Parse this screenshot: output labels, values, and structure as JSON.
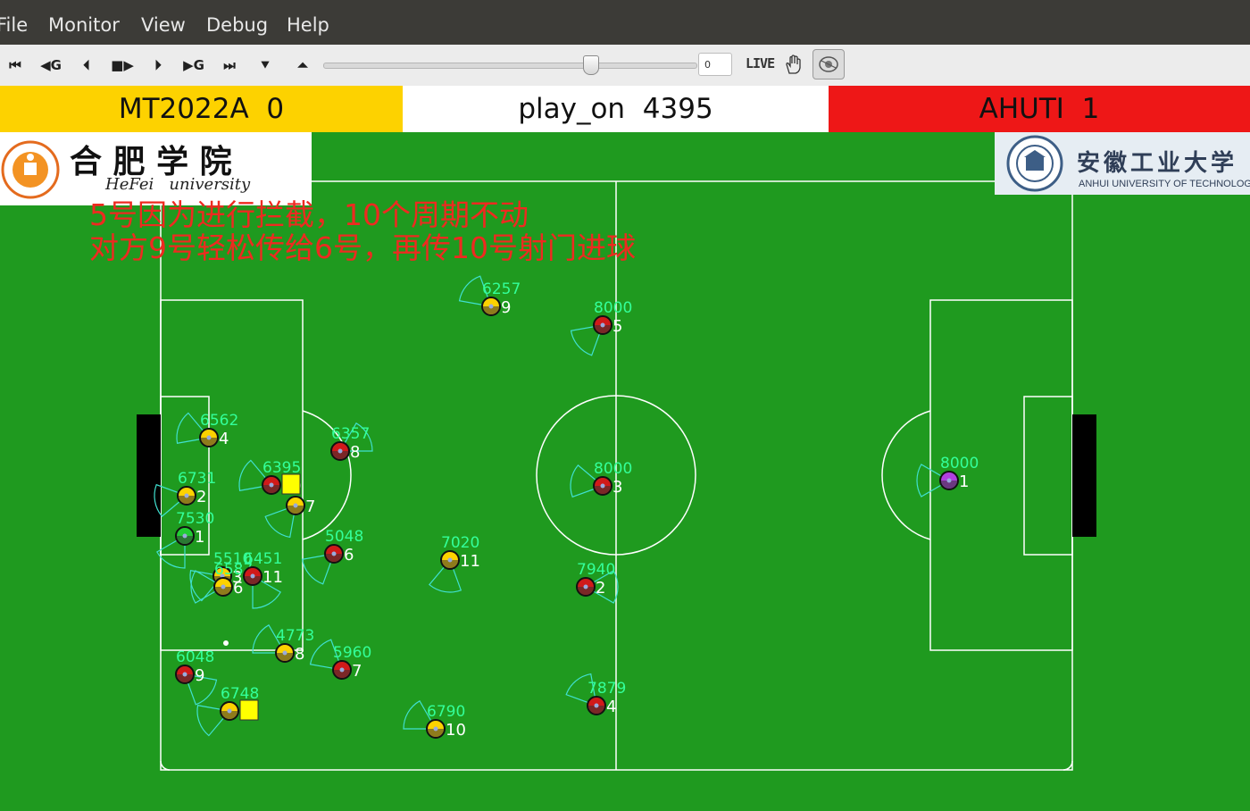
{
  "menu": [
    {
      "label": "File",
      "key": "file"
    },
    {
      "label": "Monitor",
      "key": "monitor"
    },
    {
      "label": "View",
      "key": "view"
    },
    {
      "label": "Debug",
      "key": "debug"
    },
    {
      "label": "Help",
      "key": "help"
    }
  ],
  "toolbar": {
    "buttons": [
      "rewind-to-start",
      "step-back-goal",
      "step-back",
      "play",
      "step-forward",
      "step-forward-goal",
      "forward-to-end",
      "drop-down",
      "kickoff"
    ],
    "step_value": "0",
    "live_label": "LIVE"
  },
  "score": {
    "left_team": "MT2022A",
    "left_score": "0",
    "play_mode": "play_on",
    "cycle": "4395",
    "right_team": "AHUTI",
    "right_score": "1"
  },
  "logos": {
    "left_title": "合 肥 学 院",
    "left_subtitle": "HeFei   university",
    "right_title": "安徽工业大学",
    "right_subtitle": "ANHUI UNIVERSITY OF TECHNOLOGY"
  },
  "notes": {
    "line1": "5号因为进行拦截，10个周期不动",
    "line2": "对方9号轻松传给6号，再传10号射门进球"
  },
  "colors": {
    "field": "#1f9a1f",
    "left_team": "#fdd200",
    "right_team": "#ee1717",
    "view_cone": "#40e0d0",
    "stamina_text": "#33ff99",
    "note_text": "#ee2a20"
  },
  "players": [
    {
      "team": "yellow",
      "num": "4",
      "stamina": "6562"
    },
    {
      "team": "yellow",
      "num": "2",
      "stamina": "6731"
    },
    {
      "team": "yellow",
      "num": "1",
      "stamina": "7530",
      "goalie": true
    },
    {
      "team": "yellow",
      "num": "3",
      "stamina": "5510"
    },
    {
      "team": "yellow",
      "num": "5",
      "stamina": "6748",
      "card": "yellow"
    },
    {
      "team": "yellow",
      "num": "7",
      "stamina": ""
    },
    {
      "team": "yellow",
      "num": "8",
      "stamina": "4773"
    },
    {
      "team": "yellow",
      "num": "9",
      "stamina": "6257"
    },
    {
      "team": "yellow",
      "num": "10",
      "stamina": "6790"
    },
    {
      "team": "yellow",
      "num": "11",
      "stamina": "7020"
    },
    {
      "team": "yellow",
      "num": "6",
      "stamina": "6587"
    },
    {
      "team": "red",
      "num": "8",
      "stamina": "6357"
    },
    {
      "team": "red",
      "num": "10",
      "stamina": "6395",
      "card": "yellow"
    },
    {
      "team": "red",
      "num": "6",
      "stamina": "5048"
    },
    {
      "team": "red",
      "num": "11",
      "stamina": "6451"
    },
    {
      "team": "red",
      "num": "9",
      "stamina": "6048"
    },
    {
      "team": "red",
      "num": "7",
      "stamina": "5960"
    },
    {
      "team": "red",
      "num": "5",
      "stamina": "8000"
    },
    {
      "team": "red",
      "num": "3",
      "stamina": "8000"
    },
    {
      "team": "red",
      "num": "2",
      "stamina": "7940"
    },
    {
      "team": "red",
      "num": "4",
      "stamina": "7879"
    },
    {
      "team": "red",
      "num": "1",
      "stamina": "8000",
      "goalie": true
    }
  ]
}
